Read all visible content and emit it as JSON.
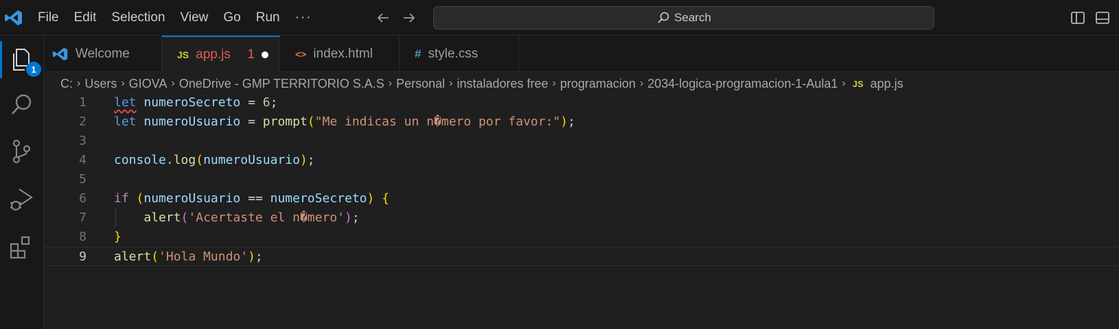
{
  "menu": {
    "file": "File",
    "edit": "Edit",
    "selection": "Selection",
    "view": "View",
    "go": "Go",
    "run": "Run",
    "more": "···"
  },
  "search": {
    "label": "Search"
  },
  "activity": {
    "explorer_badge": "1"
  },
  "tabs": [
    {
      "label": "Welcome"
    },
    {
      "label": "app.js",
      "icon": "JS",
      "problems": "1"
    },
    {
      "label": "index.html",
      "icon": "<>"
    },
    {
      "label": "style.css",
      "icon": "#"
    }
  ],
  "breadcrumb": {
    "parts": [
      "C:",
      "Users",
      "GIOVA",
      "OneDrive - GMP TERRITORIO S.A.S",
      "Personal",
      "instaladores free",
      "programacion",
      "2034-logica-programacion-1-Aula1"
    ],
    "file_icon": "JS",
    "file": "app.js"
  },
  "code": {
    "l1": {
      "kw": "let",
      "var": "numeroSecreto",
      "op": " = ",
      "num": "6",
      "end": ";"
    },
    "l2": {
      "kw": "let",
      "var": "numeroUsuario",
      "op": " = ",
      "fn": "prompt",
      "str": "\"Me indicas un n�mero por favor:\"",
      "end": ";"
    },
    "l4": {
      "obj": "console",
      "dot": ".",
      "fn": "log",
      "var": "numeroUsuario",
      "end": ";"
    },
    "l6": {
      "kw": "if",
      "var1": "numeroUsuario",
      "op": " == ",
      "var2": "numeroSecreto"
    },
    "l7": {
      "fn": "alert",
      "str": "'Acertaste el n�mero'",
      "end": ";"
    },
    "l9": {
      "fn": "alert",
      "str": "'Hola Mundo'",
      "end": ";"
    }
  },
  "line_numbers": [
    "1",
    "2",
    "3",
    "4",
    "5",
    "6",
    "7",
    "8",
    "9"
  ],
  "colors": {
    "accent": "#0078d4",
    "error": "#e35b4f",
    "editor_bg": "#1f1f1f",
    "chrome_bg": "#181818"
  }
}
